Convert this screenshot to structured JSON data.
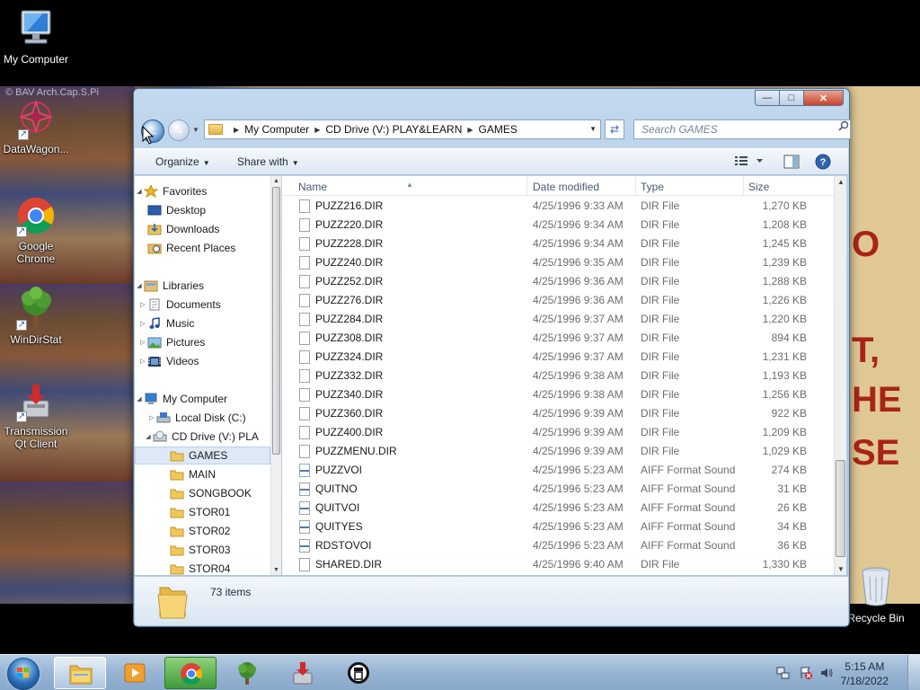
{
  "desktop": {
    "wallpaper_credit": "© BAV Arch.Cap.S.Pi",
    "wallpaper_text": [
      "O",
      "T,",
      "HE",
      "SE"
    ],
    "icons": [
      {
        "label": "My Computer",
        "icon": "computer-icon"
      },
      {
        "label": "DataWagon...",
        "icon": "datawagon-icon"
      },
      {
        "label": "Google\nChrome",
        "icon": "chrome-icon"
      },
      {
        "label": "WinDirStat",
        "icon": "windirstat-icon"
      },
      {
        "label": "Transmission\nQt Client",
        "icon": "transmission-icon"
      },
      {
        "label": "Recycle Bin",
        "icon": "recycle-bin-icon"
      }
    ]
  },
  "window": {
    "controls": {
      "minimize": "—",
      "maximize": "□",
      "close": "✕"
    },
    "address": {
      "crumbs": [
        "My Computer",
        "CD Drive (V:) PLAY&LEARN",
        "GAMES"
      ]
    },
    "search": {
      "placeholder": "Search GAMES"
    },
    "toolbar": {
      "organize": "Organize",
      "share_with": "Share with"
    },
    "nav": {
      "favorites": "Favorites",
      "desktop": "Desktop",
      "downloads": "Downloads",
      "recent": "Recent Places",
      "libraries": "Libraries",
      "documents": "Documents",
      "music": "Music",
      "pictures": "Pictures",
      "videos": "Videos",
      "computer": "My Computer",
      "local_disk": "Local Disk (C:)",
      "cd_drive": "CD Drive (V:) PLA",
      "folders": [
        "GAMES",
        "MAIN",
        "SONGBOOK",
        "STOR01",
        "STOR02",
        "STOR03",
        "STOR04"
      ]
    },
    "columns": {
      "name": "Name",
      "date": "Date modified",
      "type": "Type",
      "size": "Size"
    },
    "files": [
      {
        "name": "PUZZ216.DIR",
        "date": "4/25/1996 9:33 AM",
        "type": "DIR File",
        "size": "1,270 KB",
        "kind": "file"
      },
      {
        "name": "PUZZ220.DIR",
        "date": "4/25/1996 9:34 AM",
        "type": "DIR File",
        "size": "1,208 KB",
        "kind": "file"
      },
      {
        "name": "PUZZ228.DIR",
        "date": "4/25/1996 9:34 AM",
        "type": "DIR File",
        "size": "1,245 KB",
        "kind": "file"
      },
      {
        "name": "PUZZ240.DIR",
        "date": "4/25/1996 9:35 AM",
        "type": "DIR File",
        "size": "1,239 KB",
        "kind": "file"
      },
      {
        "name": "PUZZ252.DIR",
        "date": "4/25/1996 9:36 AM",
        "type": "DIR File",
        "size": "1,288 KB",
        "kind": "file"
      },
      {
        "name": "PUZZ276.DIR",
        "date": "4/25/1996 9:36 AM",
        "type": "DIR File",
        "size": "1,226 KB",
        "kind": "file"
      },
      {
        "name": "PUZZ284.DIR",
        "date": "4/25/1996 9:37 AM",
        "type": "DIR File",
        "size": "1,220 KB",
        "kind": "file"
      },
      {
        "name": "PUZZ308.DIR",
        "date": "4/25/1996 9:37 AM",
        "type": "DIR File",
        "size": "894 KB",
        "kind": "file"
      },
      {
        "name": "PUZZ324.DIR",
        "date": "4/25/1996 9:37 AM",
        "type": "DIR File",
        "size": "1,231 KB",
        "kind": "file"
      },
      {
        "name": "PUZZ332.DIR",
        "date": "4/25/1996 9:38 AM",
        "type": "DIR File",
        "size": "1,193 KB",
        "kind": "file"
      },
      {
        "name": "PUZZ340.DIR",
        "date": "4/25/1996 9:38 AM",
        "type": "DIR File",
        "size": "1,256 KB",
        "kind": "file"
      },
      {
        "name": "PUZZ360.DIR",
        "date": "4/25/1996 9:39 AM",
        "type": "DIR File",
        "size": "922 KB",
        "kind": "file"
      },
      {
        "name": "PUZZ400.DIR",
        "date": "4/25/1996 9:39 AM",
        "type": "DIR File",
        "size": "1,209 KB",
        "kind": "file"
      },
      {
        "name": "PUZZMENU.DIR",
        "date": "4/25/1996 9:39 AM",
        "type": "DIR File",
        "size": "1,029 KB",
        "kind": "file"
      },
      {
        "name": "PUZZVOI",
        "date": "4/25/1996 5:23 AM",
        "type": "AIFF Format Sound",
        "size": "274 KB",
        "kind": "sound"
      },
      {
        "name": "QUITNO",
        "date": "4/25/1996 5:23 AM",
        "type": "AIFF Format Sound",
        "size": "31 KB",
        "kind": "sound"
      },
      {
        "name": "QUITVOI",
        "date": "4/25/1996 5:23 AM",
        "type": "AIFF Format Sound",
        "size": "26 KB",
        "kind": "sound"
      },
      {
        "name": "QUITYES",
        "date": "4/25/1996 5:23 AM",
        "type": "AIFF Format Sound",
        "size": "34 KB",
        "kind": "sound"
      },
      {
        "name": "RDSTOVOI",
        "date": "4/25/1996 5:23 AM",
        "type": "AIFF Format Sound",
        "size": "36 KB",
        "kind": "sound"
      },
      {
        "name": "SHARED.DIR",
        "date": "4/25/1996 9:40 AM",
        "type": "DIR File",
        "size": "1,330 KB",
        "kind": "file"
      }
    ],
    "status": {
      "item_count": "73 items"
    }
  },
  "taskbar": {
    "tasks": [
      "explorer-icon",
      "media-player-icon",
      "chrome-icon",
      "windirstat-icon",
      "transmission-icon",
      "app-icon"
    ],
    "clock": {
      "time": "5:15 AM",
      "date": "7/18/2022"
    }
  }
}
